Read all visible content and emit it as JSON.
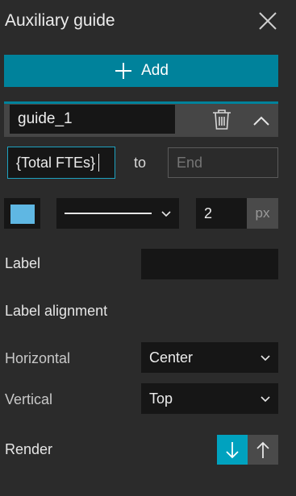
{
  "panel": {
    "title": "Auxiliary guide"
  },
  "add_button": {
    "label": "Add"
  },
  "guide": {
    "name": "guide_1"
  },
  "range": {
    "start_value": "{Total FTEs}",
    "separator": "to",
    "end_placeholder": "End"
  },
  "line_style": {
    "swatch_color": "#5fb7e3",
    "width_value": "2",
    "width_unit": "px"
  },
  "label_field": {
    "label": "Label",
    "value": ""
  },
  "label_alignment": {
    "heading": "Label alignment",
    "horizontal": {
      "label": "Horizontal",
      "value": "Center"
    },
    "vertical": {
      "label": "Vertical",
      "value": "Top"
    }
  },
  "render": {
    "label": "Render",
    "selected": "below"
  },
  "colors": {
    "accent": "#00829b",
    "accent_bright": "#00a2bf",
    "background": "#2b2b2b"
  },
  "icons": [
    "close-icon",
    "plus-icon",
    "trash-icon",
    "chevron-up-icon",
    "chevron-down-icon",
    "arrow-down-icon",
    "arrow-up-icon"
  ]
}
